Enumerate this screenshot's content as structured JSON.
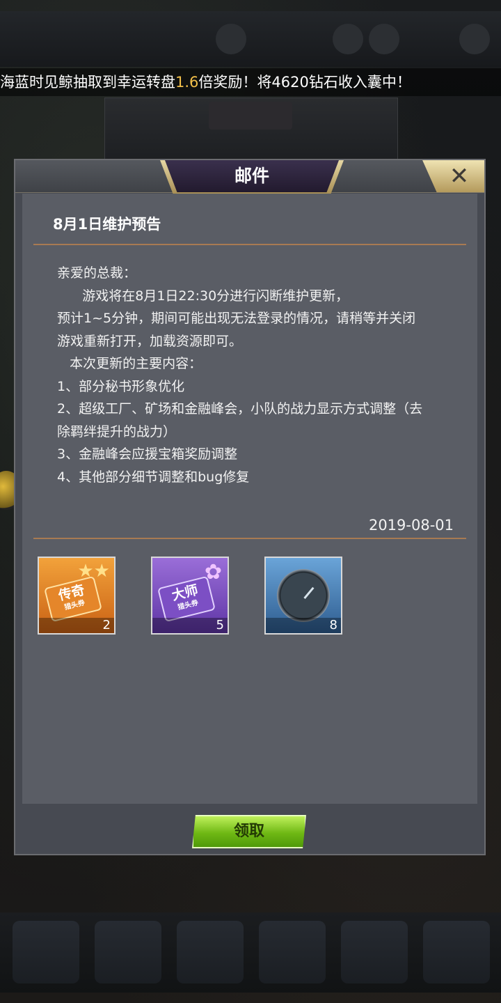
{
  "ticker": {
    "prefix": "海蓝时见鲸抽取到幸运转盘",
    "highlight": "1.6",
    "suffix": "倍奖励！将4620钻石收入囊中！"
  },
  "dialog": {
    "title": "邮件",
    "close_icon": "close-icon"
  },
  "mail": {
    "title": "8月1日维护预告",
    "lines": [
      "亲爱的总裁：",
      "      游戏将在8月1日22:30分进行闪断维护更新，",
      "预计1~5分钟，期间可能出现无法登录的情况，请稍等并关闭",
      "游戏重新打开，加载资源即可。",
      "   本次更新的主要内容：",
      "1、部分秘书形象优化",
      "2、超级工厂、矿场和金融峰会，小队的战力显示方式调整（去",
      "除羁绊提升的战力）",
      "3、金融峰会应援宝箱奖励调整",
      "4、其他部分细节调整和bug修复"
    ],
    "date": "2019-08-01"
  },
  "attachments": [
    {
      "icon": "legend-ticket-icon",
      "label": "传奇",
      "sublabel": "猎头券",
      "qty": "2"
    },
    {
      "icon": "master-ticket-icon",
      "label": "大师",
      "sublabel": "猎头券",
      "qty": "5"
    },
    {
      "icon": "stopwatch-icon",
      "qty": "8"
    }
  ],
  "claim_button": {
    "label": "领取"
  },
  "colors": {
    "highlight": "#f2c04a",
    "dialog_bg": "#474a52",
    "claim_green": "#6fb814"
  }
}
